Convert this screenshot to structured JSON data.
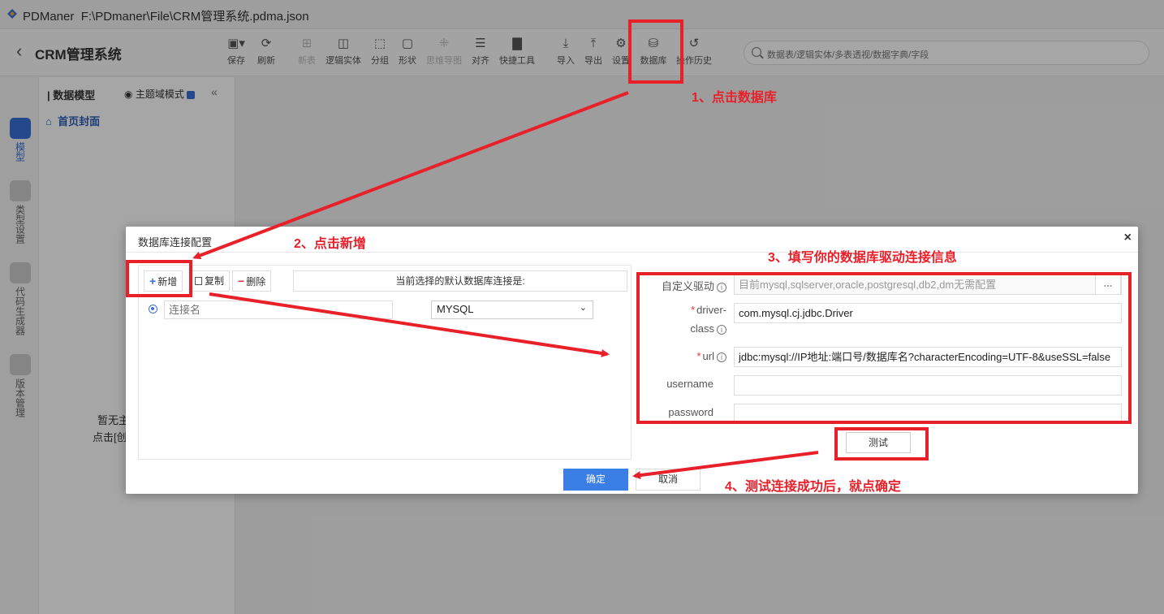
{
  "window": {
    "app_name": "PDManer",
    "file_path": "F:\\PDmaner\\File\\CRM管理系统.pdma.json"
  },
  "header": {
    "project_title": "CRM管理系统",
    "tools": [
      {
        "icon": "save-icon",
        "label": "保存"
      },
      {
        "icon": "refresh-icon",
        "label": "刷新"
      },
      {
        "icon": "new-table-icon",
        "label": "新表"
      },
      {
        "icon": "logic-entity-icon",
        "label": "逻辑实体"
      },
      {
        "icon": "group-icon",
        "label": "分组"
      },
      {
        "icon": "shape-icon",
        "label": "形状"
      },
      {
        "icon": "mindmap-icon",
        "label": "思维导图"
      },
      {
        "icon": "align-icon",
        "label": "对齐"
      },
      {
        "icon": "toolbox-icon",
        "label": "快捷工具"
      },
      {
        "icon": "import-icon",
        "label": "导入"
      },
      {
        "icon": "export-icon",
        "label": "导出"
      },
      {
        "icon": "gear-icon",
        "label": "设置"
      },
      {
        "icon": "database-icon",
        "label": "数据库"
      },
      {
        "icon": "history-icon",
        "label": "操作历史"
      }
    ],
    "search_placeholder": "数据表/逻辑实体/多表透视/数据字典/字段"
  },
  "leftnav": {
    "items": [
      "模型",
      "类型设置",
      "代码生成器",
      "版本管理"
    ]
  },
  "sidepanel": {
    "title": "数据模型",
    "mode_label": "主题域模式",
    "home_label": "首页封面",
    "empty_line1": "暂无主",
    "empty_line2": "点击[创"
  },
  "dialog": {
    "title": "数据库连接配置",
    "close": "×",
    "add_label": "新增",
    "copy_label": "复制",
    "delete_label": "删除",
    "current_default_text": "当前选择的默认数据库连接是:",
    "connection_name_placeholder": "连接名",
    "db_type_value": "MYSQL",
    "form": {
      "custom_driver_label": "自定义驱动",
      "custom_driver_placeholder": "目前mysql,sqlserver,oracle,postgresql,db2,dm无需配置",
      "driver_class_label_1": "driver-",
      "driver_class_label_2": "class",
      "driver_class_value": "com.mysql.cj.jdbc.Driver",
      "url_label": "url",
      "url_value": "jdbc:mysql://IP地址:端口号/数据库名?characterEncoding=UTF-8&useSSL=false",
      "username_label": "username",
      "password_label": "password",
      "dots_label": "..."
    },
    "test_label": "测试",
    "ok_label": "确定",
    "cancel_label": "取消"
  },
  "annotations": {
    "step1": "1、点击数据库",
    "step2": "2、点击新增",
    "step3": "3、填写你的数据库驱动连接信息",
    "step4": "4、测试连接成功后，就点确定",
    "color": "#e8202a"
  }
}
